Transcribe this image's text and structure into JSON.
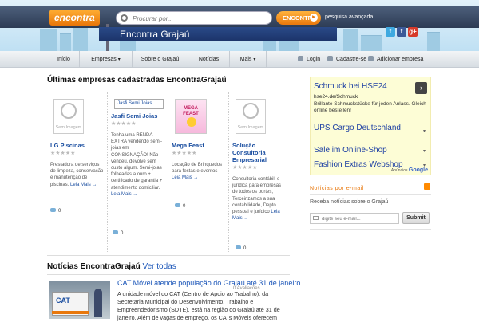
{
  "header": {
    "logo": "encontra",
    "search_placeholder": "Procurar por...",
    "search_button": "ENCONTRA",
    "advanced_search": "pesquisa avançada",
    "site_name": "Encontra Grajaú",
    "social": [
      "t",
      "f",
      "g+"
    ]
  },
  "nav": {
    "items": [
      {
        "label": "Início",
        "dropdown": false
      },
      {
        "label": "Empresas",
        "dropdown": true
      },
      {
        "label": "Sobre o Grajaú",
        "dropdown": false
      },
      {
        "label": "Notícias",
        "dropdown": false
      },
      {
        "label": "Mais",
        "dropdown": true
      }
    ],
    "right": [
      "Login",
      "Cadastre-se",
      "Adicionar empresa"
    ]
  },
  "companies": {
    "heading": "Últimas empresas cadastradas EncontraGrajaú",
    "no_image": "Sem Imagem",
    "read_more": "Leia Mais →",
    "cards": [
      {
        "title": "LG Piscinas",
        "thumb": "none",
        "thumb_label": "",
        "desc": "Prestadora de serviços de limpeza, conservação e manutenção de piscinas.",
        "comments": "0"
      },
      {
        "title": "Jasfi Semi Joias",
        "thumb": "label",
        "thumb_label": "Jasfi Semi Joias",
        "desc": "Tenha uma RENDA EXTRA vendendo semi-joias em CONSIGNAÇÃO! Não vendeu, devolve sem custo algum. Semi-joias folheadas a ouro + certificado de garantia + atendimento domiciliar.",
        "comments": "0"
      },
      {
        "title": "Mega Feast",
        "thumb": "logo",
        "thumb_label": "MEGA FEAST",
        "desc": "Locação de Brinquedos para festas e eventos",
        "comments": "0"
      },
      {
        "title": "Solução Consultoria Empresarial",
        "thumb": "none",
        "thumb_label": "",
        "desc": "Consultoria contábil, e jurídica para empresas de todos os portes, Terceirizamos a sua contabilidade, Depto pessoal e jurídico",
        "comments": "0"
      }
    ]
  },
  "news": {
    "heading": "Notícias EncontraGrajaú",
    "see_all": "Ver todas",
    "item": {
      "title": "CAT Móvel atende população do Grajaú até 31 de janeiro",
      "ratings": "0 Avaliações",
      "body": "A unidade móvel do CAT (Centro de Apoio ao Trabalho), da Secretaria Municipal do Desenvolvimento, Trabalho e Empreendedorismo (SDTE), está na região do Grajaú até 31 de janeiro. Além de vagas de emprego, os CATs Móveis oferecem",
      "image_text": "CAT"
    }
  },
  "sidebar": {
    "ad": {
      "headline": "Schmuck bei HSE24",
      "url": "hse24.de/Schmuck",
      "desc": "Brillante Schmuckstücke für jeden Anlass. Gleich online bestellen!",
      "links": [
        "UPS Cargo Deutschland",
        "Sale im Online-Shop",
        "Fashion Extras Webshop"
      ],
      "by": "Anúncios",
      "brand": "Google"
    },
    "news_title": "Notícias por e-mail",
    "news_desc": "Receba notícias sobre o Grajaú",
    "email_placeholder": "digite seu e-mail...",
    "submit": "Submit"
  }
}
